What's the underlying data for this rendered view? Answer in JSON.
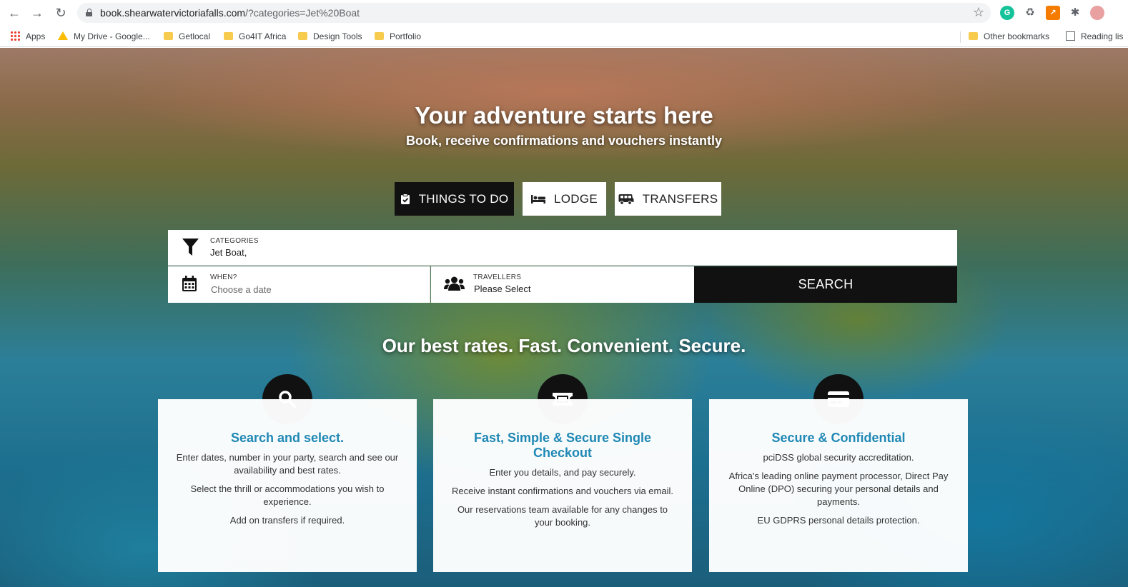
{
  "browser": {
    "url_host": "book.shearwatervictoriafalls.com",
    "url_rest": "/?categories=Jet%20Boat",
    "bookmarks": [
      "Apps",
      "My Drive - Google...",
      "Getlocal",
      "Go4IT Africa",
      "Design Tools",
      "Portfolio"
    ],
    "other_bookmarks": "Other bookmarks",
    "reading_list": "Reading lis"
  },
  "hero": {
    "title": "Your adventure starts here",
    "subtitle": "Book, receive confirmations and vouchers instantly"
  },
  "tabs": [
    {
      "label": "THINGS TO DO",
      "icon": "clipboard-check-icon",
      "active": true
    },
    {
      "label": "LODGE",
      "icon": "bed-icon",
      "active": false
    },
    {
      "label": "TRANSFERS",
      "icon": "bus-icon",
      "active": false
    }
  ],
  "search": {
    "categories_label": "CATEGORIES",
    "categories_value": "Jet Boat,",
    "when_label": "WHEN?",
    "when_placeholder": "Choose a date",
    "travellers_label": "TRAVELLERS",
    "travellers_value": "Please Select",
    "button": "SEARCH"
  },
  "tagline": "Our best rates. Fast. Convenient. Secure.",
  "features": [
    {
      "icon": "search-icon",
      "title": "Search and select.",
      "lines": [
        "Enter dates, number in your party, search and see our availability and best rates.",
        "Select the thrill or accommodations you wish to experience.",
        "Add on transfers if required."
      ]
    },
    {
      "icon": "ticket-icon",
      "title": "Fast, Simple & Secure Single Checkout",
      "lines": [
        "Enter you details, and pay securely.",
        "Receive instant confirmations and vouchers via email.",
        "Our reservations team available for any changes to your booking."
      ]
    },
    {
      "icon": "credit-card-icon",
      "title": "Secure & Confidential",
      "lines": [
        "pciDSS global security accreditation.",
        "Africa's leading online payment processor, Direct Pay Online (DPO) securing your personal details and payments.",
        "EU GDPRS personal details protection."
      ]
    }
  ],
  "colors": {
    "accent": "#1f88b5",
    "dark": "#111111"
  }
}
